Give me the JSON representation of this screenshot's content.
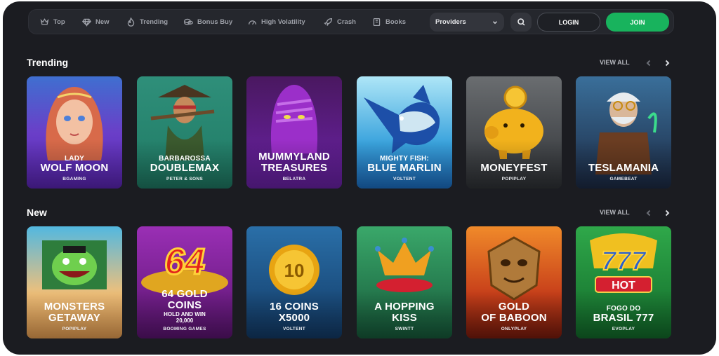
{
  "nav": {
    "items": [
      {
        "label": "Top",
        "icon": "crown-icon"
      },
      {
        "label": "New",
        "icon": "diamond-icon"
      },
      {
        "label": "Trending",
        "icon": "fire-icon"
      },
      {
        "label": "Bonus Buy",
        "icon": "coins-icon"
      },
      {
        "label": "High Volatility",
        "icon": "gauge-icon"
      },
      {
        "label": "Crash",
        "icon": "rocket-icon"
      },
      {
        "label": "Books",
        "icon": "book-icon"
      }
    ],
    "providers_label": "Providers",
    "login_label": "LOGIN",
    "join_label": "JOIN"
  },
  "colors": {
    "accent": "#18b35d",
    "background": "#1b1c21",
    "nav_bg": "#25272d"
  },
  "sections": [
    {
      "title": "Trending",
      "view_all": "VIEW ALL",
      "games": [
        {
          "sub": "LADY",
          "main": "WOLF MOON",
          "provider": "BGAMING"
        },
        {
          "sub": "BARBAROSSA",
          "main": "DOUBLEMAX",
          "provider": "PETER & SONS"
        },
        {
          "sub": "",
          "main": "MUMMYLAND",
          "main2": "TREASURES",
          "provider": "BELATRA"
        },
        {
          "sub": "MIGHTY FISH:",
          "main": "BLUE MARLIN",
          "provider": "VOLTENT"
        },
        {
          "sub": "",
          "main": "MONEYFEST",
          "provider": "POPIPLAY"
        },
        {
          "sub": "",
          "main": "TESLAMANIA",
          "provider": "GAMEBEAT"
        }
      ]
    },
    {
      "title": "New",
      "view_all": "VIEW ALL",
      "games": [
        {
          "main": "MONSTERS",
          "main2": "GETAWAY",
          "provider": "POPIPLAY"
        },
        {
          "badge": "64",
          "main": "64 GOLD",
          "main2": "COINS",
          "small": "HOLD AND WIN",
          "small2": "20,000",
          "provider": "BOOMING GAMES"
        },
        {
          "coin": "10",
          "main": "16 COINS",
          "main2": "X5000",
          "provider": "VOLTENT"
        },
        {
          "main": "A HOPPING",
          "main2": "KISS",
          "provider": "SWINTT"
        },
        {
          "main": "GOLD",
          "main2": "OF BABOON",
          "provider": "ONLYPLAY"
        },
        {
          "badge": "777",
          "logo_text": "HOT",
          "sub": "FOGO DO",
          "main": "BRASIL 777",
          "provider": "EVOPLAY"
        }
      ]
    }
  ]
}
